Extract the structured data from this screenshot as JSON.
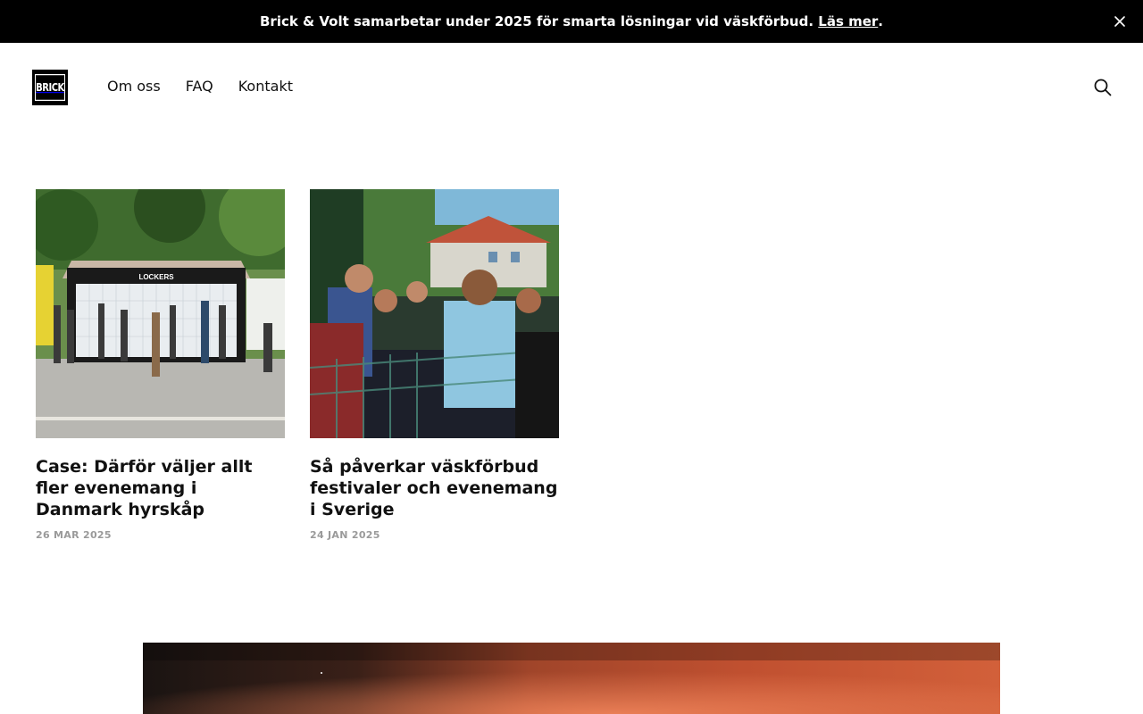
{
  "announcement": {
    "text": "Brick & Volt samarbetar under 2025 för smarta lösningar vid väskförbud.",
    "link_label": "Läs mer",
    "suffix": ".",
    "close_icon": "close-icon"
  },
  "header": {
    "logo_text": "BRICK",
    "nav": [
      {
        "label": "Om oss"
      },
      {
        "label": "FAQ"
      },
      {
        "label": "Kontakt"
      }
    ],
    "search_icon": "search-icon"
  },
  "articles": [
    {
      "title": "Case: Därför väljer allt fler evenemang i Danmark hyrskåp",
      "date": "26 MAR 2025",
      "image_sign": "LOCKERS"
    },
    {
      "title": "Så påverkar väskförbud festivaler och evenemang i Sverige",
      "date": "24 JAN 2025"
    }
  ],
  "colors": {
    "bar_bg": "#000000",
    "text": "#111111",
    "date": "#9a9a9a"
  }
}
